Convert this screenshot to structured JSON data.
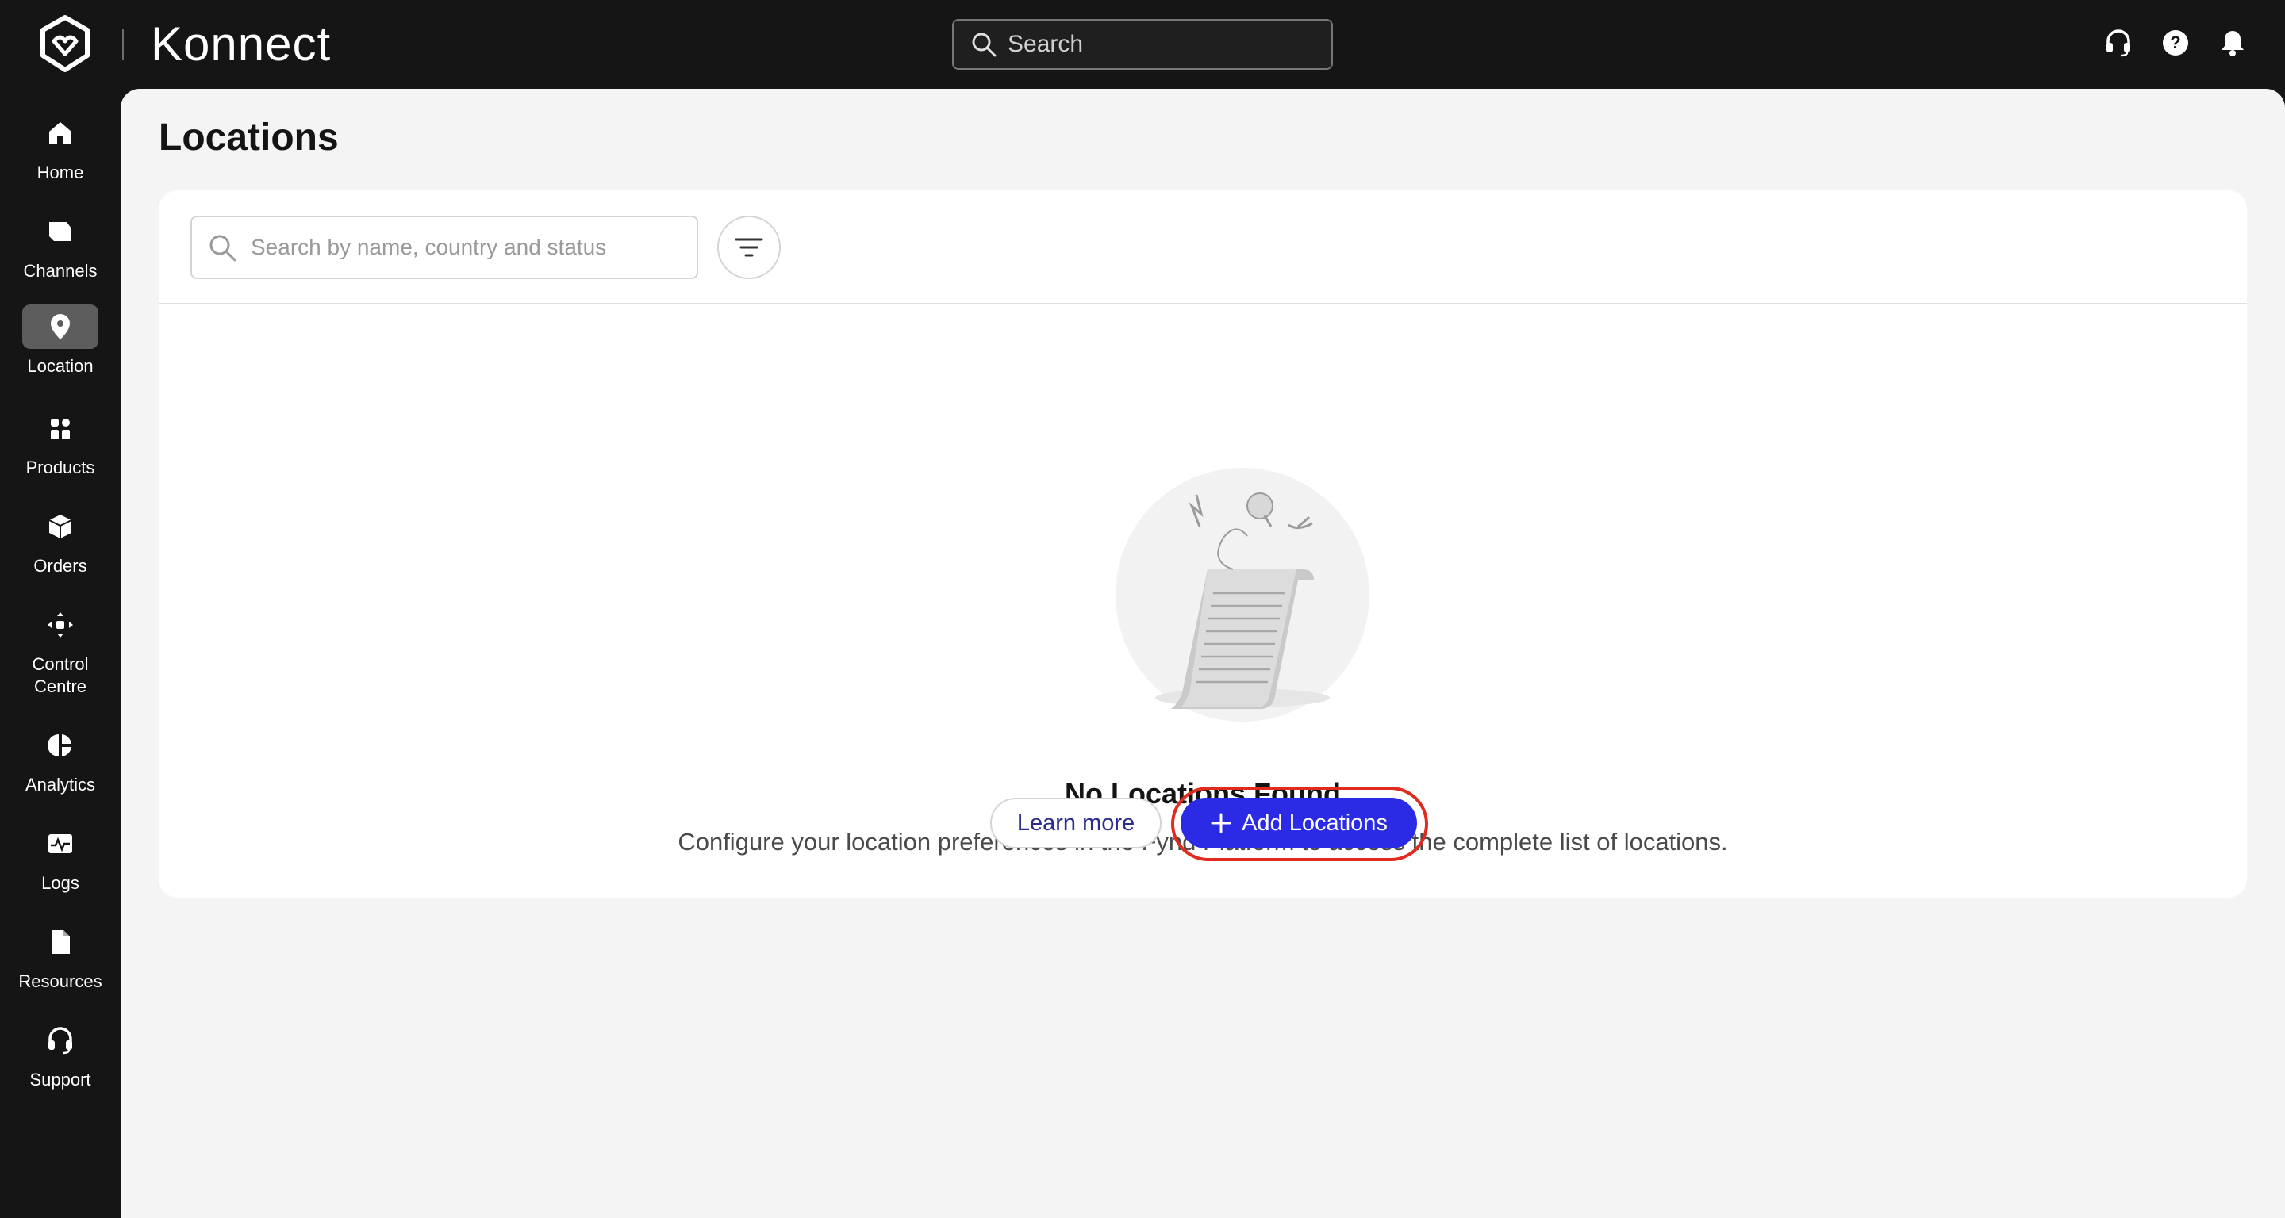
{
  "app": {
    "brand": "Konnect"
  },
  "topbar": {
    "search_placeholder": "Search",
    "icons": [
      "headset-icon",
      "help-icon",
      "bell-icon"
    ]
  },
  "sidebar": {
    "items": [
      {
        "label": "Home",
        "icon": "home-icon"
      },
      {
        "label": "Channels",
        "icon": "channels-icon"
      },
      {
        "label": "Location",
        "icon": "location-pin-icon",
        "active": true
      },
      {
        "label": "Products",
        "icon": "products-icon"
      },
      {
        "label": "Orders",
        "icon": "orders-box-icon"
      },
      {
        "label": "Control Centre",
        "icon": "control-centre-icon"
      },
      {
        "label": "Analytics",
        "icon": "analytics-pie-icon"
      },
      {
        "label": "Logs",
        "icon": "logs-icon"
      },
      {
        "label": "Resources",
        "icon": "resources-doc-icon"
      },
      {
        "label": "Support",
        "icon": "support-headset-icon"
      }
    ]
  },
  "main": {
    "title": "Locations",
    "search_placeholder": "Search by name, country and status",
    "empty_state": {
      "title": "No Locations Found",
      "description": "Configure your location preferences in the Fynd Platform to access the complete list of locations.",
      "learn_more_label": "Learn more",
      "add_label": "Add Locations"
    }
  },
  "colors": {
    "topbar_bg": "#151515",
    "accent": "#2b2be6",
    "highlight_ring": "#e02b1f",
    "link": "#2b2b8c"
  }
}
